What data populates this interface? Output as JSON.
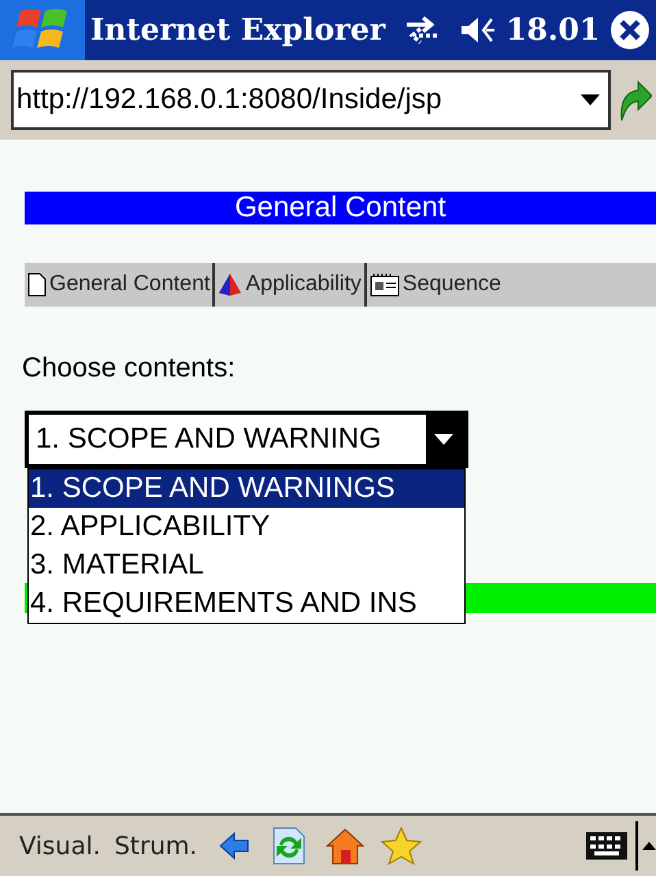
{
  "title_bar": {
    "title": "Internet Explorer",
    "time": "18.01"
  },
  "address_bar": {
    "value": "http://192.168.0.1:8080/Inside/jsp"
  },
  "page": {
    "heading": "General Content",
    "tabs": [
      {
        "label": "General Content",
        "kind": "page"
      },
      {
        "label": "Applicability",
        "kind": "shape"
      },
      {
        "label": "Sequence",
        "kind": "list"
      }
    ],
    "prompt": "Choose contents:",
    "select": {
      "value": "1. SCOPE AND WARNING",
      "expanded": true,
      "options": [
        {
          "label": "1. SCOPE AND WARNINGS",
          "selected": true
        },
        {
          "label": "2. APPLICABILITY",
          "selected": false
        },
        {
          "label": "3. MATERIAL",
          "selected": false
        },
        {
          "label": "4. REQUIREMENTS AND INS",
          "selected": false
        }
      ]
    }
  },
  "menu_bar": {
    "items": [
      "Visual.",
      "Strum."
    ]
  }
}
